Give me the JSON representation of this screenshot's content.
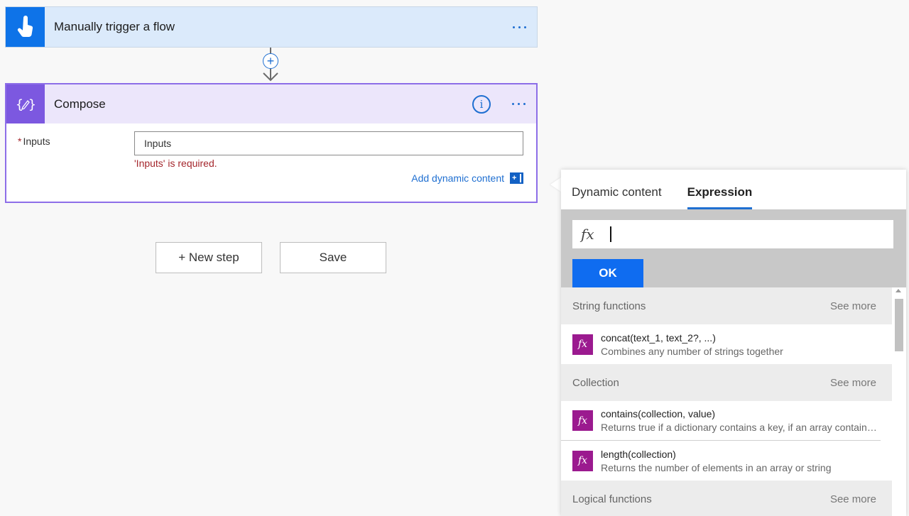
{
  "trigger": {
    "title": "Manually trigger a flow"
  },
  "compose": {
    "title": "Compose",
    "required_marker": "*",
    "inputs_label": "Inputs",
    "inputs_placeholder": "Inputs",
    "error": "'Inputs' is required.",
    "add_dynamic_label": "Add dynamic content",
    "add_dynamic_icon_glyph": "+"
  },
  "connector": {
    "add_glyph": "+"
  },
  "actions": {
    "new_step_label": "+ New step",
    "save_label": "Save"
  },
  "panel": {
    "tabs": [
      {
        "label": "Dynamic content",
        "active": false
      },
      {
        "label": "Expression",
        "active": true
      }
    ],
    "fx_glyph": "fx",
    "ok_label": "OK",
    "sections": [
      {
        "title": "String functions",
        "see_more": "See more",
        "items": [
          {
            "name": "concat(text_1, text_2?, ...)",
            "desc": "Combines any number of strings together"
          }
        ]
      },
      {
        "title": "Collection",
        "see_more": "See more",
        "items": [
          {
            "name": "contains(collection, value)",
            "desc": "Returns true if a dictionary contains a key, if an array contains a value, or if a string contains a substring"
          },
          {
            "name": "length(collection)",
            "desc": "Returns the number of elements in an array or string"
          }
        ]
      },
      {
        "title": "Logical functions",
        "see_more": "See more",
        "items": []
      }
    ]
  },
  "colors": {
    "trigger_accent": "#0e73e8",
    "compose_accent": "#7c58e0",
    "link_blue": "#1f6fd1",
    "error_red": "#a4262c",
    "function_icon": "#9b1a8f",
    "ok_button": "#0f6cf0"
  },
  "icons": {
    "trigger": "touch-hand-icon",
    "compose": "compose-braces-icon",
    "info": "info-icon",
    "more": "more-dots-icon",
    "function": "fx-function-icon"
  }
}
